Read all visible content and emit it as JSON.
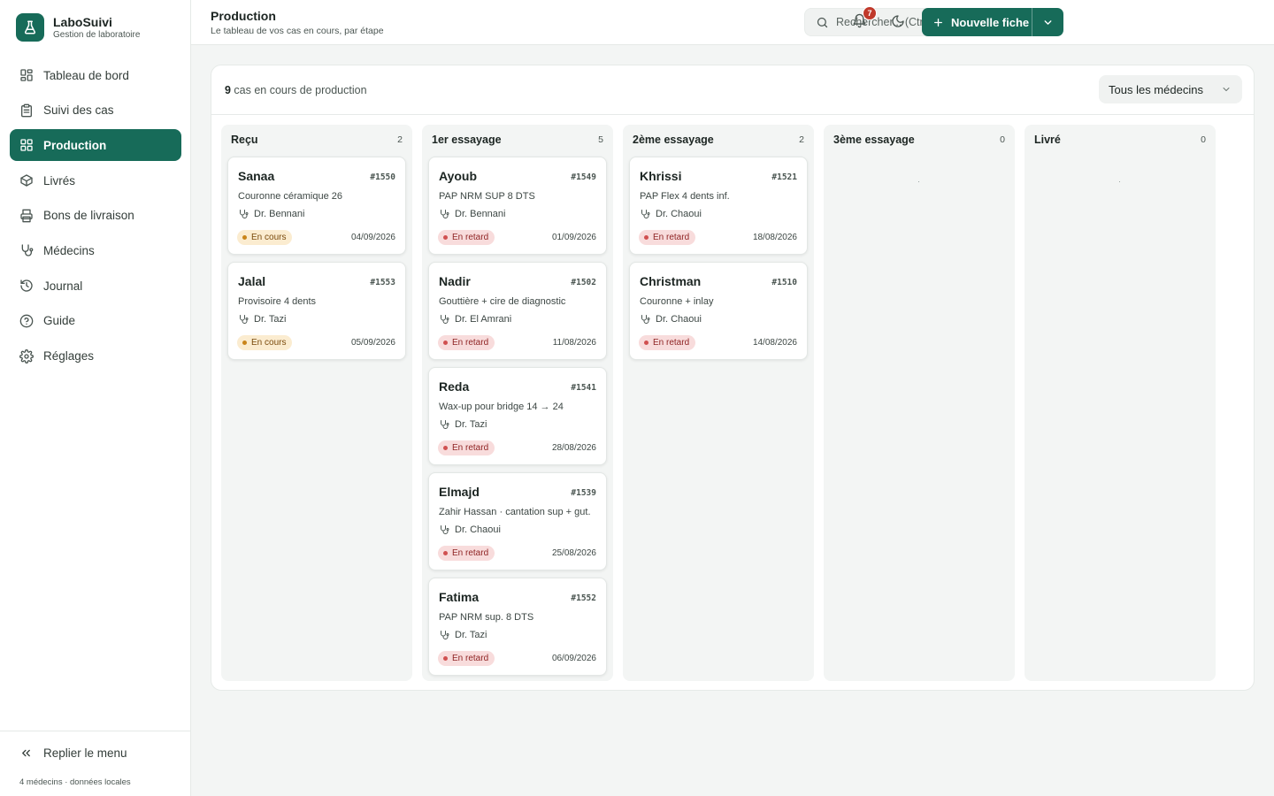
{
  "brand": {
    "name": "LaboSuivi",
    "subtitle": "Gestion de laboratoire"
  },
  "nav": [
    {
      "label": "Tableau de bord",
      "icon": "dashboard-icon",
      "active": false
    },
    {
      "label": "Suivi des cas",
      "icon": "clipboard-icon",
      "active": false
    },
    {
      "label": "Production",
      "icon": "kanban-icon",
      "active": true
    },
    {
      "label": "Livrés",
      "icon": "package-icon",
      "active": false
    },
    {
      "label": "Bons de livraison",
      "icon": "printer-icon",
      "active": false
    },
    {
      "label": "Médecins",
      "icon": "stethoscope-icon",
      "active": false
    },
    {
      "label": "Journal",
      "icon": "history-icon",
      "active": false
    },
    {
      "label": "Guide",
      "icon": "help-icon",
      "active": false
    },
    {
      "label": "Réglages",
      "icon": "gear-icon",
      "active": false
    }
  ],
  "sidebar_footer": {
    "collapse_label": "Replier le menu",
    "note": "4 médecins · données locales"
  },
  "header": {
    "title": "Production",
    "subtitle": "Le tableau de vos cas en cours, par étape",
    "search_placeholder": "Rechercher... (Ctrl+K)",
    "notifications_count": "7",
    "new_button_label": "Nouvelle fiche"
  },
  "toolbar": {
    "case_count": "9",
    "case_count_suffix": " cas en cours de production",
    "doctor_filter": "Tous les médecins"
  },
  "colors": {
    "accent": "#176b59",
    "late": "#d05050",
    "in_progress": "#c98419"
  },
  "columns": [
    {
      "title": "Reçu",
      "count": "2",
      "cards": [
        {
          "name": "Sanaa",
          "id": "#1550",
          "desc": "Couronne céramique 26",
          "doctor": "Dr. Bennani",
          "status": "En cours",
          "status_type": "cours",
          "date": "04/09/2026"
        },
        {
          "name": "Jalal",
          "id": "#1553",
          "desc": "Provisoire 4 dents",
          "doctor": "Dr. Tazi",
          "status": "En cours",
          "status_type": "cours",
          "date": "05/09/2026"
        }
      ]
    },
    {
      "title": "1er essayage",
      "count": "5",
      "cards": [
        {
          "name": "Ayoub",
          "id": "#1549",
          "desc": "PAP NRM SUP 8 DTS",
          "doctor": "Dr. Bennani",
          "status": "En retard",
          "status_type": "retard",
          "date": "01/09/2026"
        },
        {
          "name": "Nadir",
          "id": "#1502",
          "desc": "Gouttière + cire de diagnostic",
          "doctor": "Dr. El Amrani",
          "status": "En retard",
          "status_type": "retard",
          "date": "11/08/2026"
        },
        {
          "name": "Reda",
          "id": "#1541",
          "desc": "Wax-up pour bridge 14 → 24",
          "doctor": "Dr. Tazi",
          "status": "En retard",
          "status_type": "retard",
          "date": "28/08/2026"
        },
        {
          "name": "Elmajd",
          "id": "#1539",
          "desc": "Zahir Hassan · cantation sup + gut.",
          "doctor": "Dr. Chaoui",
          "status": "En retard",
          "status_type": "retard",
          "date": "25/08/2026"
        },
        {
          "name": "Fatima",
          "id": "#1552",
          "desc": "PAP NRM sup. 8 DTS",
          "doctor": "Dr. Tazi",
          "status": "En retard",
          "status_type": "retard",
          "date": "06/09/2026"
        }
      ]
    },
    {
      "title": "2ème essayage",
      "count": "2",
      "cards": [
        {
          "name": "Khrissi",
          "id": "#1521",
          "desc": "PAP Flex 4 dents inf.",
          "doctor": "Dr. Chaoui",
          "status": "En retard",
          "status_type": "retard",
          "date": "18/08/2026"
        },
        {
          "name": "Christman",
          "id": "#1510",
          "desc": "Couronne + inlay",
          "doctor": "Dr. Chaoui",
          "status": "En retard",
          "status_type": "retard",
          "date": "14/08/2026"
        }
      ]
    },
    {
      "title": "3ème essayage",
      "count": "0",
      "cards": []
    },
    {
      "title": "Livré",
      "count": "0",
      "cards": []
    }
  ]
}
